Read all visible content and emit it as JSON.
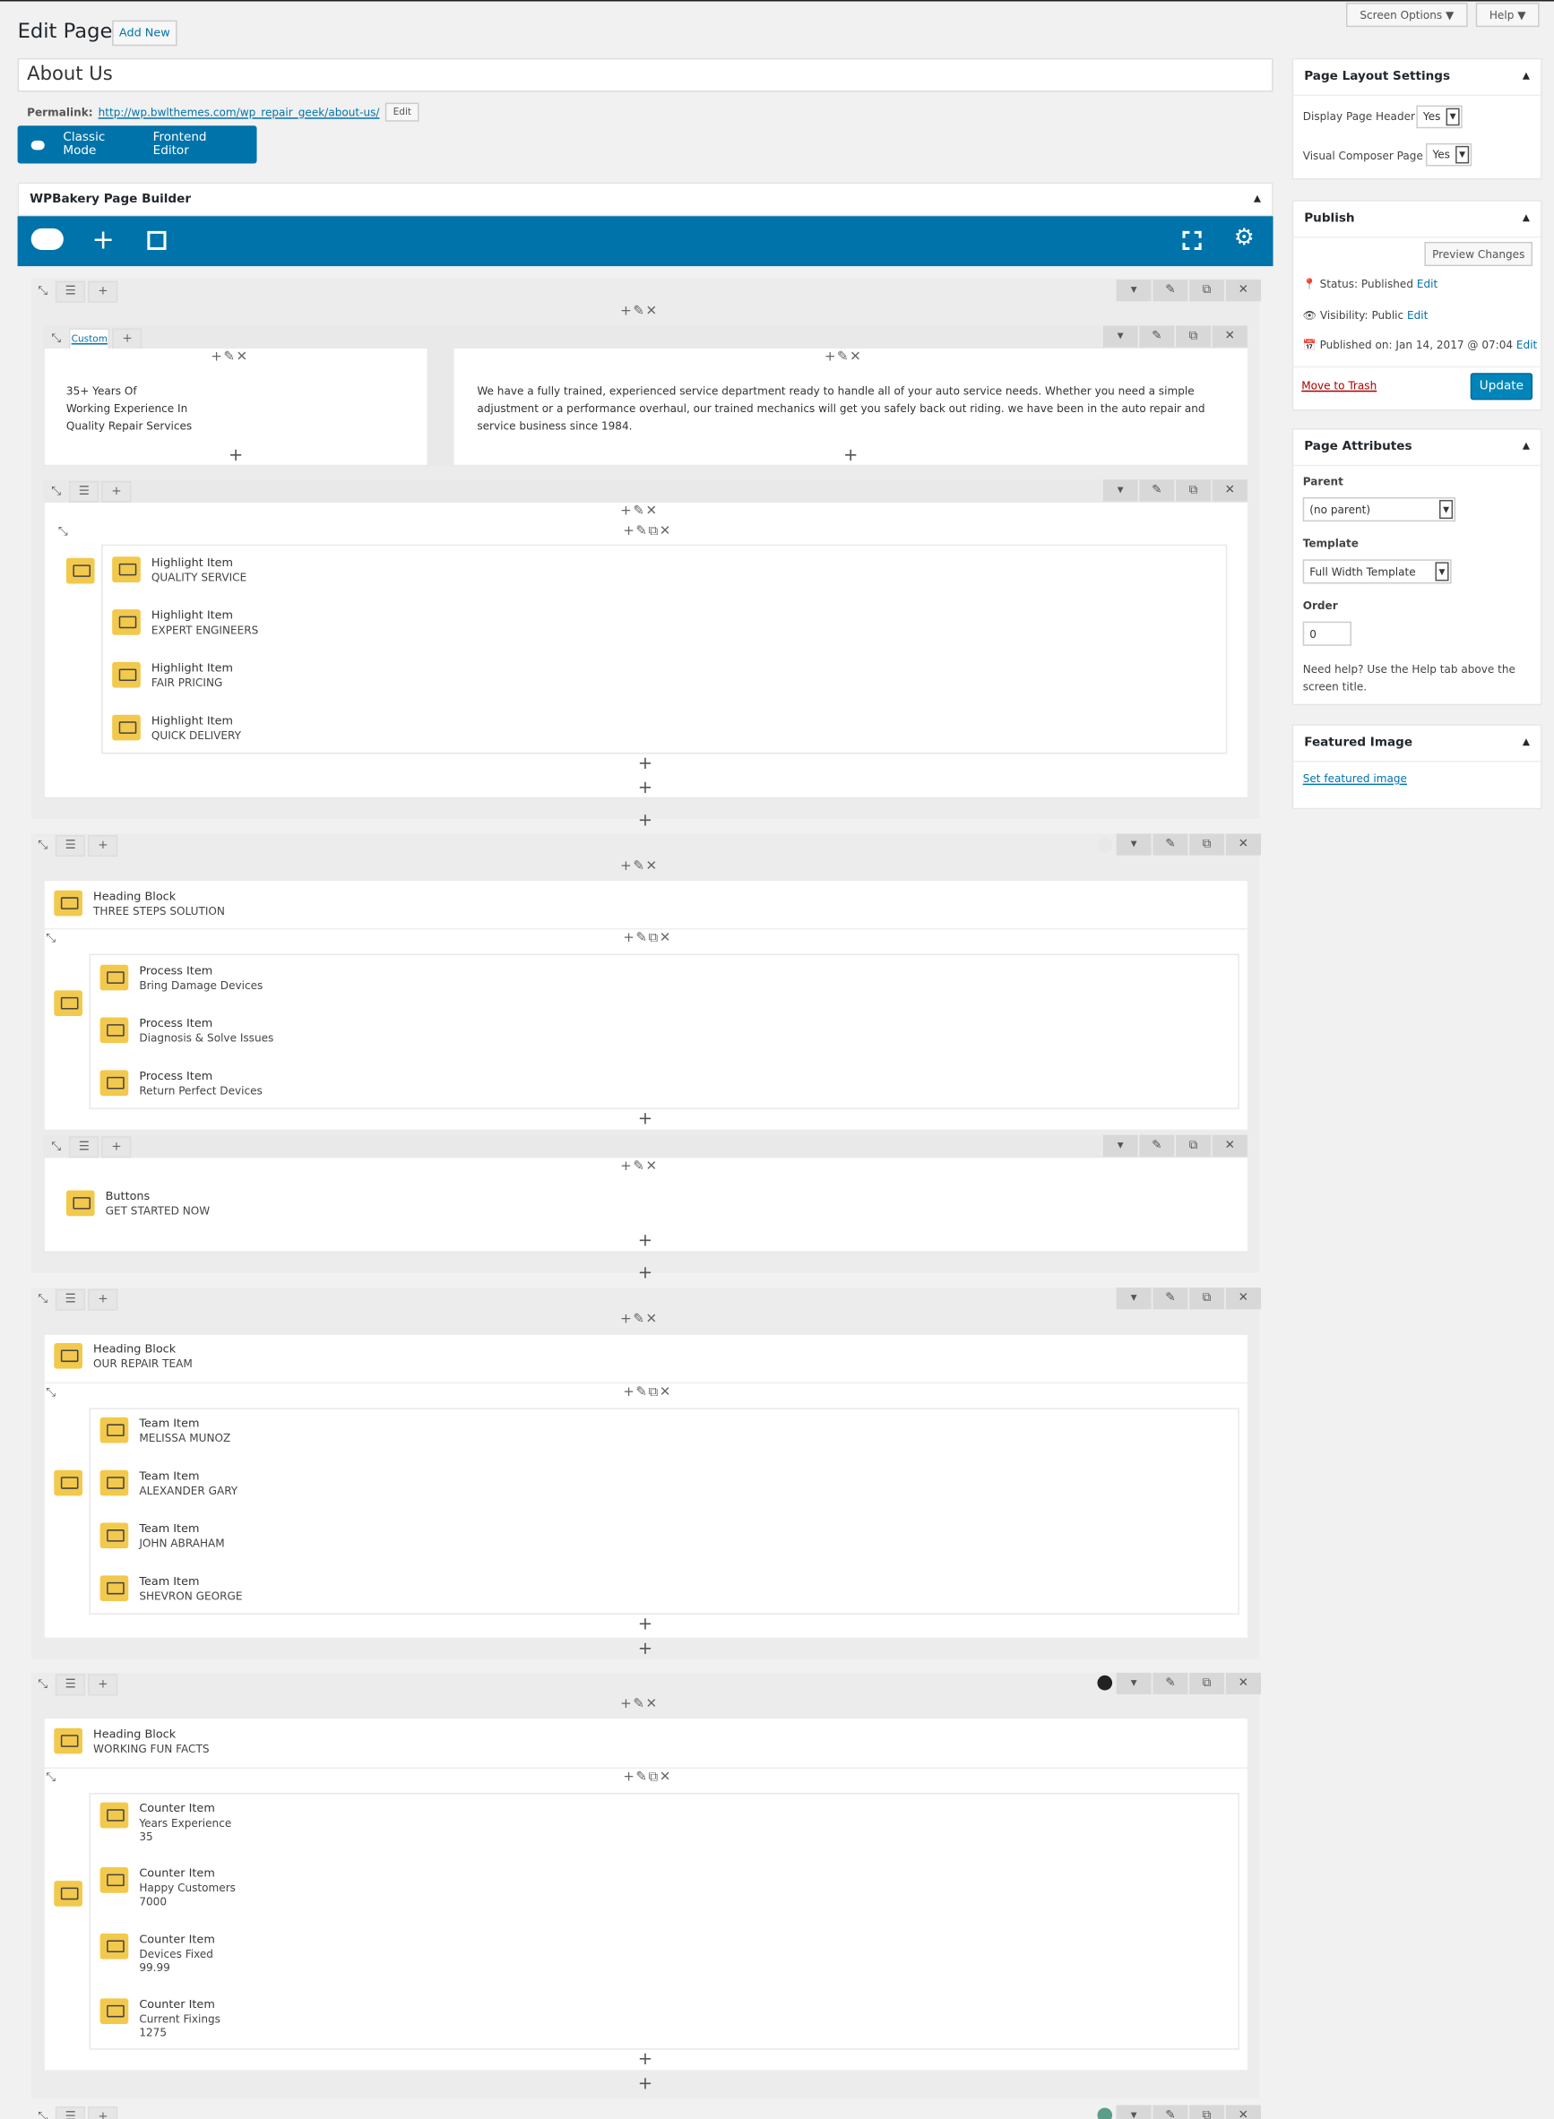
{
  "header": {
    "title": "Edit Page",
    "add_new": "Add New",
    "screen_options": "Screen Options ▼",
    "help": "Help ▼"
  },
  "page_title": "About Us",
  "permalink": {
    "label": "Permalink:",
    "url": "http://wp.bwlthemes.com/wp_repair_geek/about-us/",
    "edit": "Edit"
  },
  "mode": {
    "classic": "Classic Mode",
    "frontend": "Frontend Editor"
  },
  "wpb": {
    "title": "WPBakery Page Builder"
  },
  "row1": {
    "tag": "Custom",
    "col1": [
      "35+ Years Of",
      "Working Experience In",
      "Quality Repair Services"
    ],
    "col2": "We have a fully trained, experienced service department ready to handle all of your auto service needs. Whether you need a simple adjustment or a performance overhaul, our trained mechanics will get you safely back out riding. we have been in the auto repair and service business since 1984."
  },
  "highlights": [
    {
      "t": "Highlight Item",
      "s": "QUALITY SERVICE"
    },
    {
      "t": "Highlight Item",
      "s": "EXPERT ENGINEERS"
    },
    {
      "t": "Highlight Item",
      "s": "FAIR PRICING"
    },
    {
      "t": "Highlight Item",
      "s": "QUICK DELIVERY"
    }
  ],
  "steps": {
    "heading": {
      "t": "Heading Block",
      "s": "THREE STEPS SOLUTION"
    },
    "items": [
      {
        "t": "Process Item",
        "s": "Bring Damage Devices"
      },
      {
        "t": "Process Item",
        "s": "Diagnosis & Solve Issues"
      },
      {
        "t": "Process Item",
        "s": "Return Perfect Devices"
      }
    ],
    "button": {
      "t": "Buttons",
      "s": "GET STARTED NOW"
    }
  },
  "team": {
    "heading": {
      "t": "Heading Block",
      "s": "OUR REPAIR TEAM"
    },
    "items": [
      {
        "t": "Team Item",
        "s": "MELISSA MUNOZ"
      },
      {
        "t": "Team Item",
        "s": "ALEXANDER GARY"
      },
      {
        "t": "Team Item",
        "s": "JOHN ABRAHAM"
      },
      {
        "t": "Team Item",
        "s": "SHEVRON GEORGE"
      }
    ]
  },
  "facts": {
    "heading": {
      "t": "Heading Block",
      "s": "WORKING FUN FACTS"
    },
    "items": [
      {
        "t": "Counter Item",
        "s": "Years Experience",
        "v": "35"
      },
      {
        "t": "Counter Item",
        "s": "Happy Customers",
        "v": "7000"
      },
      {
        "t": "Counter Item",
        "s": "Devices Fixed",
        "v": "99.99"
      },
      {
        "t": "Counter Item",
        "s": "Current Fixings",
        "v": "1275"
      }
    ]
  },
  "layout_settings": {
    "title": "Page Layout Settings",
    "header_label": "Display Page Header",
    "header_val": "Yes",
    "vc_label": "Visual Composer Page",
    "vc_val": "Yes"
  },
  "publish": {
    "title": "Publish",
    "preview": "Preview Changes",
    "status": "Status: Published",
    "status_edit": "Edit",
    "visibility": "Visibility: Public",
    "vis_edit": "Edit",
    "published": "Published on: Jan 14, 2017 @ 07:04",
    "pub_edit": "Edit",
    "trash": "Move to Trash",
    "update": "Update"
  },
  "attributes": {
    "title": "Page Attributes",
    "parent_label": "Parent",
    "parent_val": "(no parent)",
    "template_label": "Template",
    "template_val": "Full Width Template",
    "order_label": "Order",
    "order_val": "0",
    "help": "Need help? Use the Help tab above the screen title."
  },
  "featured": {
    "title": "Featured Image",
    "link": "Set featured image"
  },
  "colors": {
    "accent": "#0073aa",
    "icon": "#f2c94c",
    "dot_dark": "#222222",
    "dot_green": "#5a9e8a"
  }
}
